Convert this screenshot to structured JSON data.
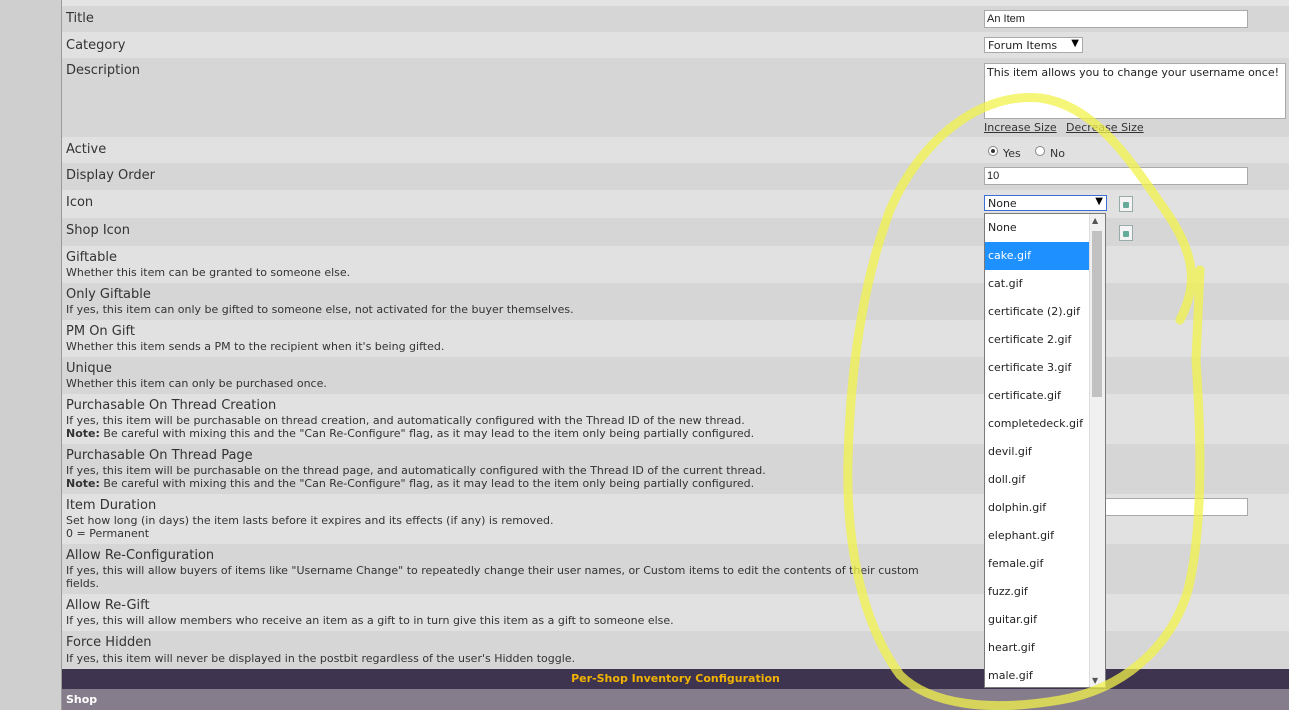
{
  "form": {
    "rows": [
      {
        "label": "Title"
      },
      {
        "label": "Category"
      },
      {
        "label": "Description"
      },
      {
        "label": "Active"
      },
      {
        "label": "Display Order"
      },
      {
        "label": "Icon"
      },
      {
        "label": "Shop Icon"
      },
      {
        "label": "Giftable",
        "desc": "Whether this item can be granted to someone else."
      },
      {
        "label": "Only Giftable",
        "desc": "If yes, this item can only be gifted to someone else, not activated for the buyer themselves."
      },
      {
        "label": "PM On Gift",
        "desc": "Whether this item sends a PM to the recipient when it's being gifted."
      },
      {
        "label": "Unique",
        "desc": "Whether this item can only be purchased once."
      },
      {
        "label": "Purchasable On Thread Creation",
        "desc": "If yes, this item will be purchasable on thread creation, and automatically configured with the Thread ID of the new thread.",
        "note_label": "Note:",
        "note": " Be careful with mixing this and the \"Can Re-Configure\" flag, as it may lead to the item only being partially configured."
      },
      {
        "label": "Purchasable On Thread Page",
        "desc": "If yes, this item will be purchasable on the thread page, and automatically configured with the Thread ID of the current thread.",
        "note_label": "Note:",
        "note": " Be careful with mixing this and the \"Can Re-Configure\" flag, as it may lead to the item only being partially configured."
      },
      {
        "label": "Item Duration",
        "desc": "Set how long (in days) the item lasts before it expires and its effects (if any) is removed.",
        "desc2": "0 = Permanent"
      },
      {
        "label": "Allow Re-Configuration",
        "desc": "If yes, this will allow buyers of items like \"Username Change\" to repeatedly change their user names, or Custom items to edit the contents of their custom",
        "desc2": "fields."
      },
      {
        "label": "Allow Re-Gift",
        "desc": "If yes, this will allow members who receive an item as a gift to in turn give this item as a gift to someone else."
      },
      {
        "label": "Force Hidden",
        "desc": "If yes, this item will never be displayed in the postbit regardless of the user's Hidden toggle."
      }
    ],
    "title_value": "An Item",
    "category_value": "Forum Items",
    "description_value": "This item allows you to change your username once!",
    "increase_size": "Increase Size",
    "decrease_size": "Decrease Size",
    "active_yes": "Yes",
    "active_no": "No",
    "active_selected": "Yes",
    "display_order_value": "10",
    "icon_value": "None"
  },
  "icon_dropdown": {
    "options": [
      "None",
      "cake.gif",
      "cat.gif",
      "certificate (2).gif",
      "certificate 2.gif",
      "certificate 3.gif",
      "certificate.gif",
      "completedeck.gif",
      "devil.gif",
      "doll.gif",
      "dolphin.gif",
      "elephant.gif",
      "female.gif",
      "fuzz.gif",
      "guitar.gif",
      "heart.gif",
      "male.gif"
    ],
    "highlighted": "cake.gif"
  },
  "section_header": "Per-Shop Inventory Configuration",
  "section_sub": "Shop",
  "colors": {
    "header_bg": "#3e3450",
    "header_text": "#f2b300",
    "sub_bg": "#857d8b",
    "highlight": "#1e90ff",
    "annotation": "#f2f24a"
  }
}
